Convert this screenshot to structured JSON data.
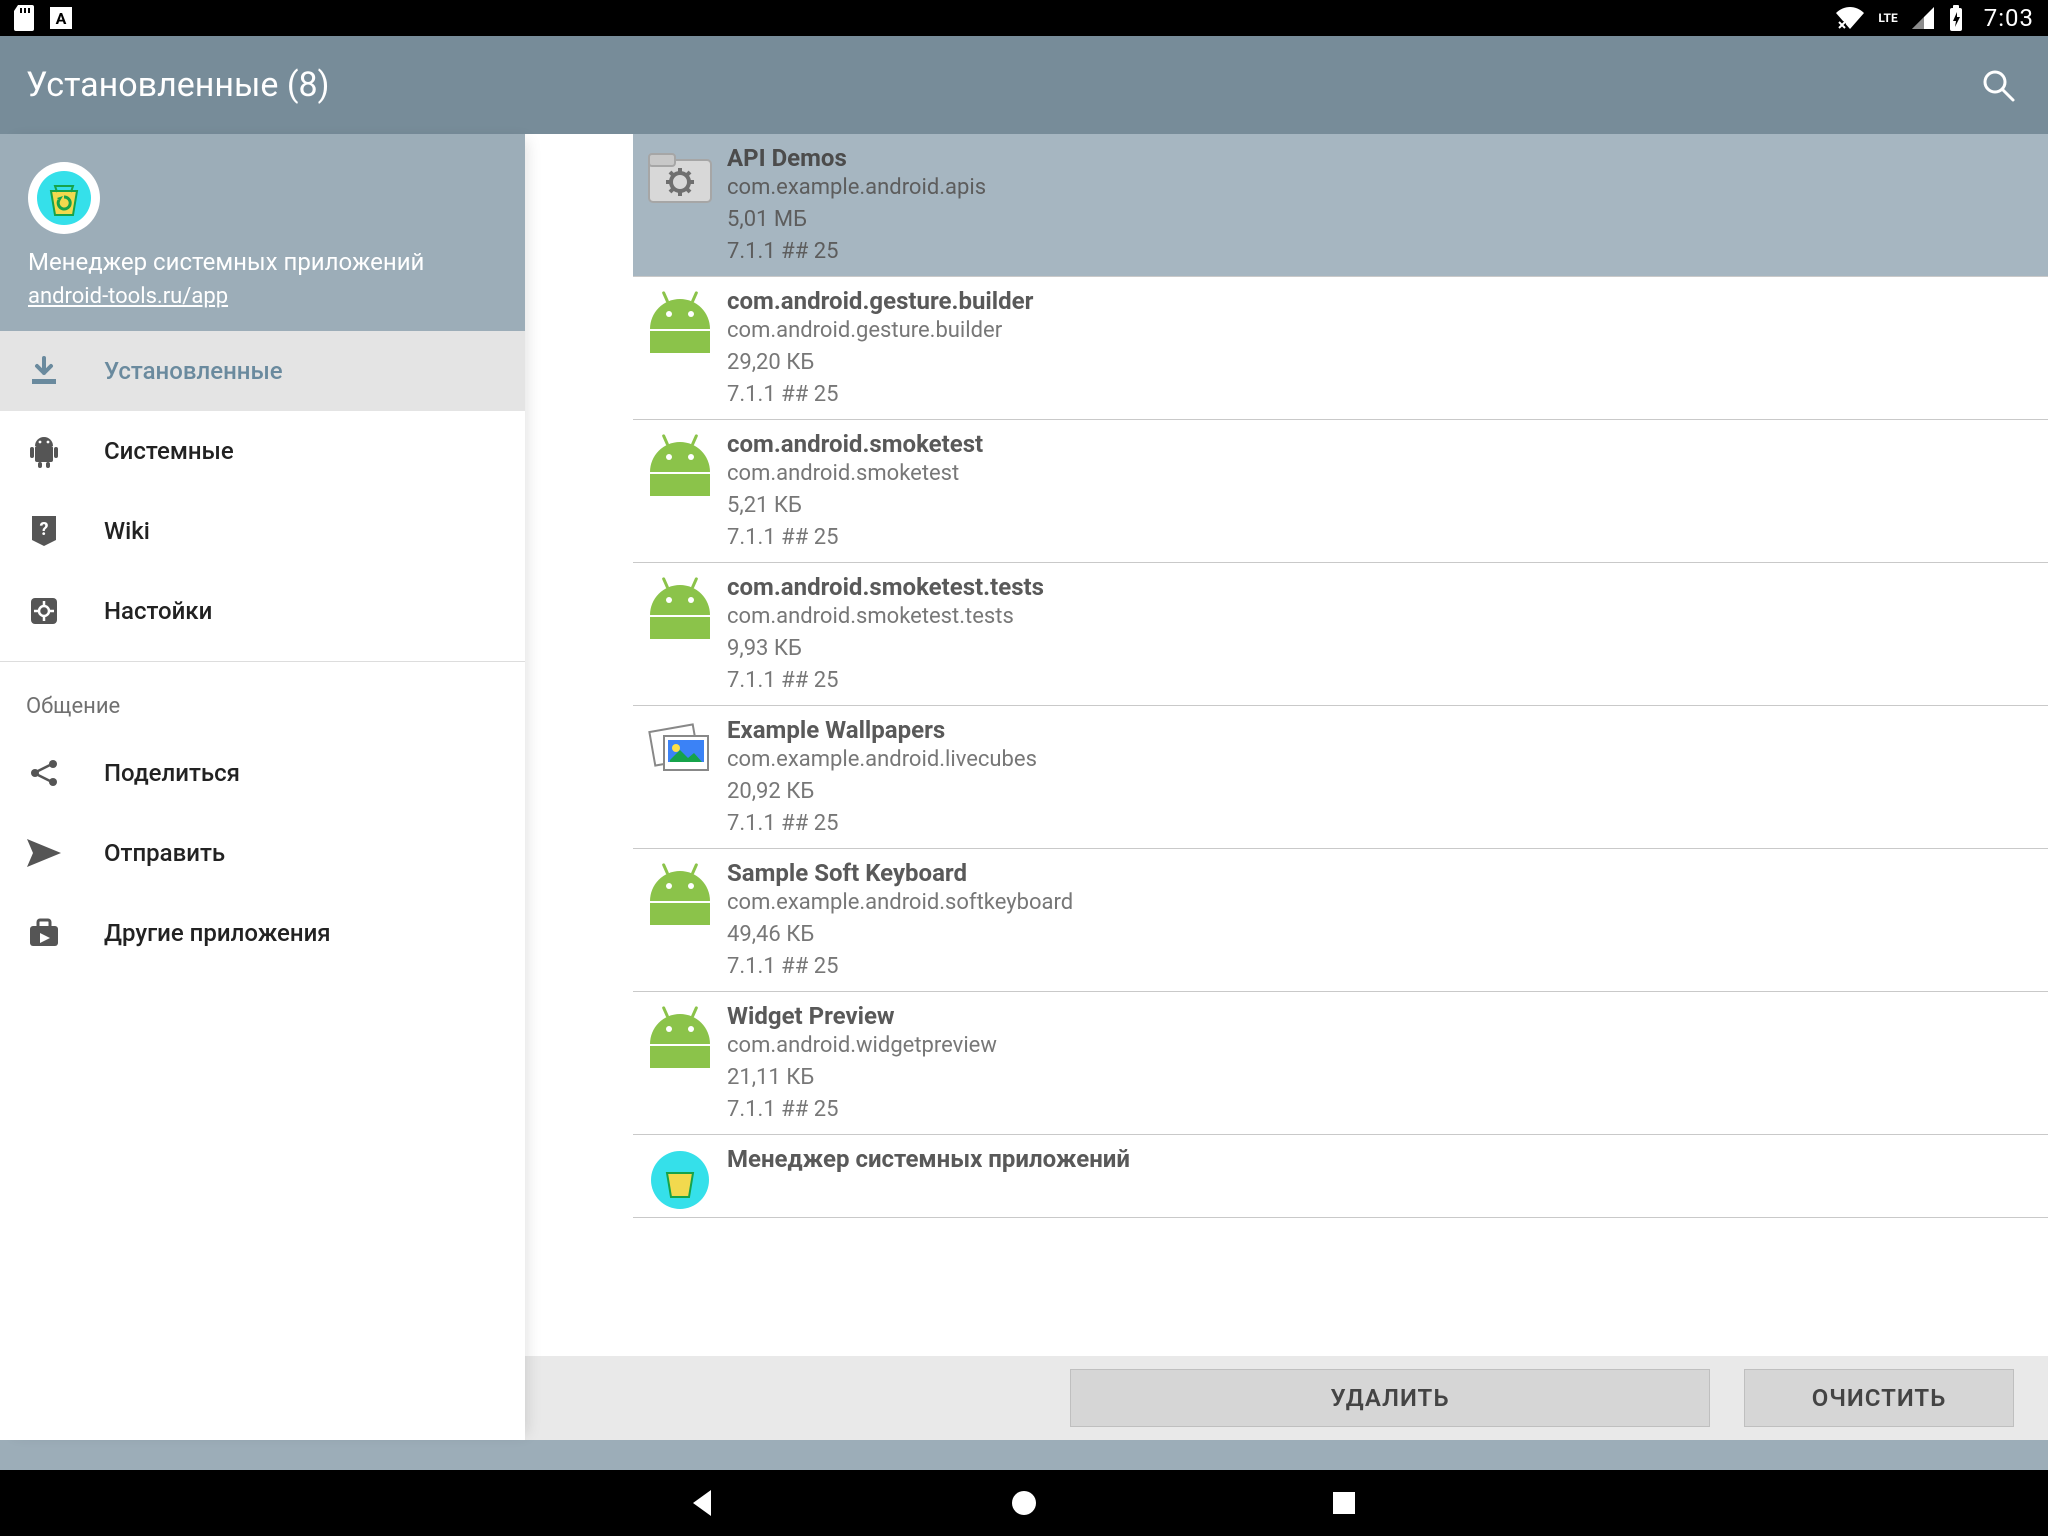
{
  "status": {
    "clock": "7:03",
    "lte": "LTE"
  },
  "header": {
    "title": "Установленные (8)"
  },
  "sidebar": {
    "app_name": "Менеджер системных приложений",
    "app_link": "android-tools.ru/app",
    "items": [
      {
        "label": "Установленные",
        "icon": "download-icon",
        "active": true
      },
      {
        "label": "Системные",
        "icon": "android-icon",
        "active": false
      },
      {
        "label": "Wiki",
        "icon": "question-badge-icon",
        "active": false
      },
      {
        "label": "Настойки",
        "icon": "gear-badge-icon",
        "active": false
      }
    ],
    "section_label": "Общение",
    "items2": [
      {
        "label": "Поделиться",
        "icon": "share-icon"
      },
      {
        "label": "Отправить",
        "icon": "send-icon"
      },
      {
        "label": "Другие приложения",
        "icon": "shop-icon"
      }
    ]
  },
  "apps": [
    {
      "title": "API Demos",
      "pkg": "com.example.android.apis",
      "size": "5,01 МБ",
      "ver": "7.1.1 ## 25",
      "icon": "folder-gear",
      "selected": true
    },
    {
      "title": "com.android.gesture.builder",
      "pkg": "com.android.gesture.builder",
      "size": "29,20 КБ",
      "ver": "7.1.1 ## 25",
      "icon": "droid",
      "selected": false
    },
    {
      "title": "com.android.smoketest",
      "pkg": "com.android.smoketest",
      "size": "5,21 КБ",
      "ver": "7.1.1 ## 25",
      "icon": "droid",
      "selected": false
    },
    {
      "title": "com.android.smoketest.tests",
      "pkg": "com.android.smoketest.tests",
      "size": "9,93 КБ",
      "ver": "7.1.1 ## 25",
      "icon": "droid",
      "selected": false
    },
    {
      "title": "Example Wallpapers",
      "pkg": "com.example.android.livecubes",
      "size": "20,92 КБ",
      "ver": "7.1.1 ## 25",
      "icon": "photos",
      "selected": false
    },
    {
      "title": "Sample Soft Keyboard",
      "pkg": "com.example.android.softkeyboard",
      "size": "49,46 КБ",
      "ver": "7.1.1 ## 25",
      "icon": "droid",
      "selected": false
    },
    {
      "title": "Widget Preview",
      "pkg": "com.android.widgetpreview",
      "size": "21,11 КБ",
      "ver": "7.1.1 ## 25",
      "icon": "droid",
      "selected": false
    },
    {
      "title": "Менеджер системных приложений",
      "pkg": "",
      "size": "",
      "ver": "",
      "icon": "recycle",
      "selected": false
    }
  ],
  "buttons": {
    "delete": "УДАЛИТЬ",
    "clear": "ОЧИСТИТЬ"
  }
}
